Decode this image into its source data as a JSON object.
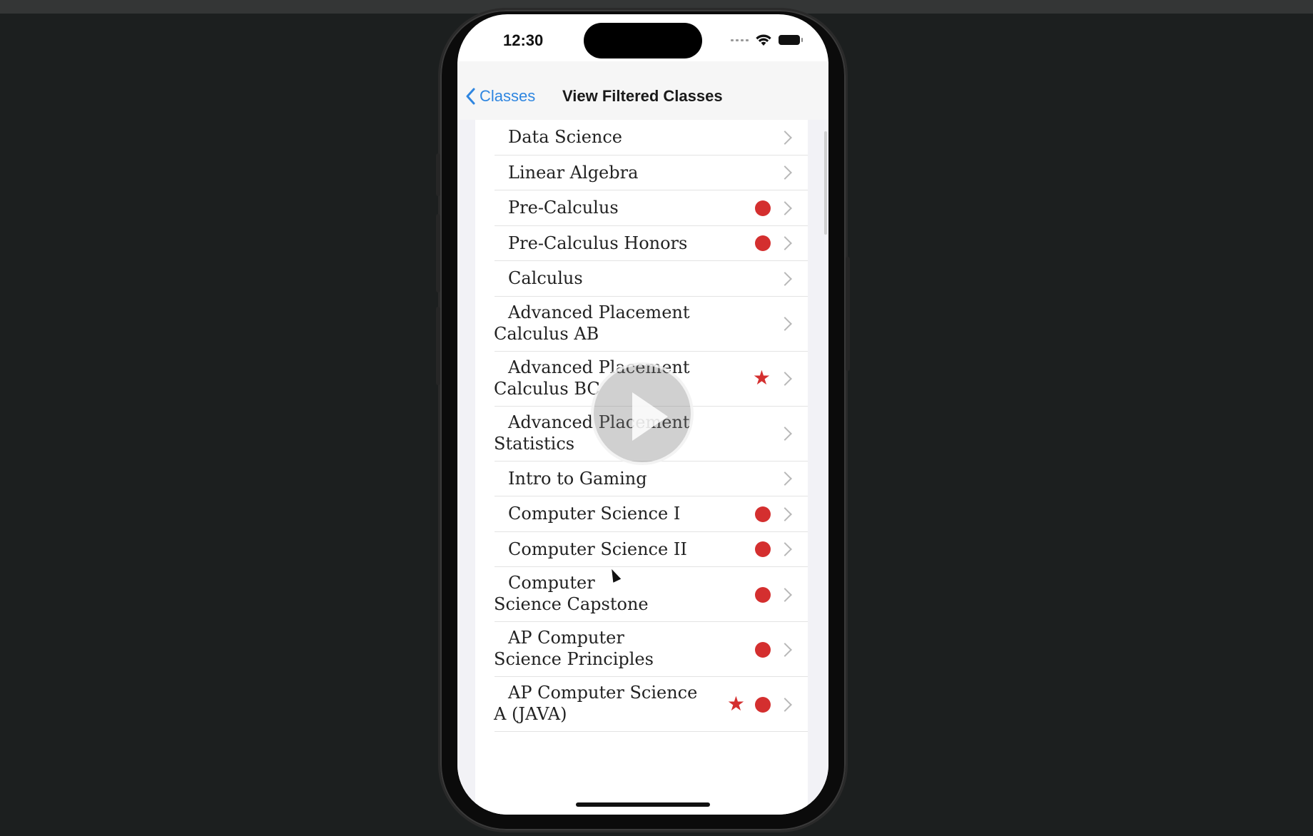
{
  "status_bar": {
    "time": "12:30"
  },
  "nav": {
    "back_label": "Classes",
    "title": "View Filtered Classes"
  },
  "classes": [
    {
      "line1": "Data Science",
      "line2": "",
      "dot": false,
      "star": false
    },
    {
      "line1": "Linear Algebra",
      "line2": "",
      "dot": false,
      "star": false
    },
    {
      "line1": "Pre-Calculus",
      "line2": "",
      "dot": true,
      "star": false
    },
    {
      "line1": "Pre-Calculus Honors",
      "line2": "",
      "dot": true,
      "star": false
    },
    {
      "line1": "Calculus",
      "line2": "",
      "dot": false,
      "star": false
    },
    {
      "line1": "Advanced Placement",
      "line2": "Calculus AB",
      "dot": false,
      "star": false
    },
    {
      "line1": "Advanced Placement",
      "line2": "Calculus BC",
      "dot": false,
      "star": true
    },
    {
      "line1": "Advanced Placement",
      "line2": "Statistics",
      "dot": false,
      "star": false
    },
    {
      "line1": "Intro to Gaming",
      "line2": "",
      "dot": false,
      "star": false
    },
    {
      "line1": "Computer Science I",
      "line2": "",
      "dot": true,
      "star": false
    },
    {
      "line1": "Computer Science II",
      "line2": "",
      "dot": true,
      "star": false
    },
    {
      "line1": "Computer",
      "line2": "Science Capstone",
      "dot": true,
      "star": false
    },
    {
      "line1": "AP Computer",
      "line2": "Science Principles",
      "dot": true,
      "star": false
    },
    {
      "line1": "AP Computer Science",
      "line2": "A (JAVA)",
      "dot": true,
      "star": true
    }
  ],
  "colors": {
    "accent": "#2f86e0",
    "marker": "#d42f2f"
  }
}
